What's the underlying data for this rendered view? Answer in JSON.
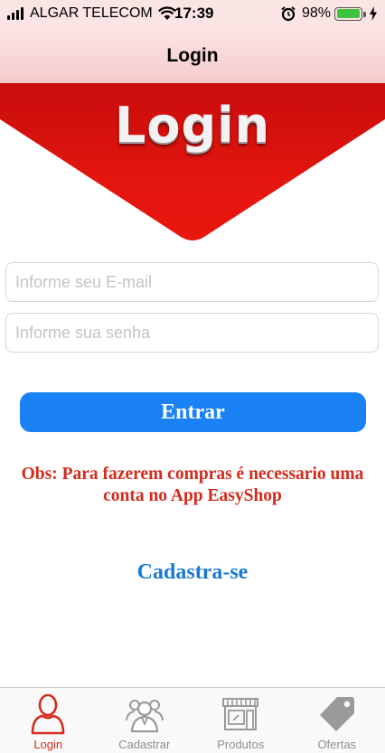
{
  "status_bar": {
    "carrier": "ALGAR TELECOM",
    "time": "17:39",
    "battery": "98%",
    "battery_level": 0.98,
    "icons": [
      "signal-icon",
      "wifi-icon",
      "alarm-icon",
      "battery-icon",
      "charging-icon"
    ]
  },
  "nav": {
    "title": "Login"
  },
  "banner": {
    "title": "Login",
    "color": "#d8130f"
  },
  "form": {
    "email_placeholder": "Informe seu E-mail",
    "email_value": "",
    "password_placeholder": "Informe sua senha",
    "password_value": "",
    "submit_label": "Entrar",
    "submit_color": "#1a82f5"
  },
  "notice": "Obs: Para fazerem compras é necessario uma conta no App EasyShop",
  "register_link": "Cadastra-se",
  "tabs": [
    {
      "label": "Login",
      "icon": "user-icon",
      "active": true
    },
    {
      "label": "Cadastrar",
      "icon": "group-icon",
      "active": false
    },
    {
      "label": "Produtos",
      "icon": "store-icon",
      "active": false
    },
    {
      "label": "Ofertas",
      "icon": "tag-icon",
      "active": false
    }
  ],
  "colors": {
    "accent": "#d62a1f",
    "inactive": "#8e8e8e",
    "link": "#1a7ad6"
  }
}
